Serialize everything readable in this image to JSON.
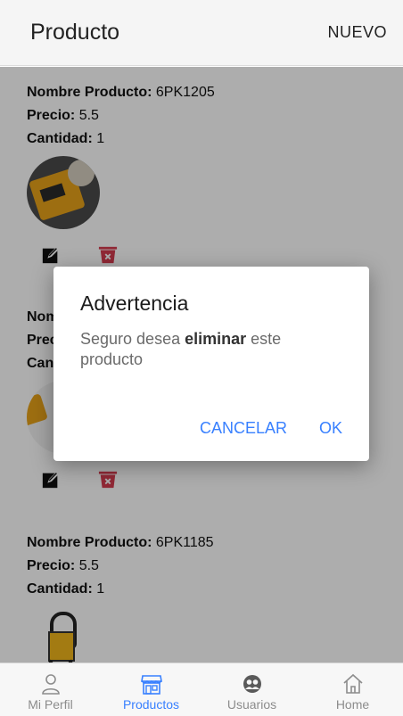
{
  "header": {
    "title": "Producto",
    "new_label": "NUEVO"
  },
  "products": [
    {
      "name_label": "Nombre Producto:",
      "name": "6PK1205",
      "price_label": "Precio:",
      "price": "5.5",
      "qty_label": "Cantidad:",
      "qty": "1"
    },
    {
      "name_label": "Nombre Producto:",
      "name": "",
      "price_label": "Precio:",
      "price": "",
      "qty_label": "Cantidad:",
      "qty": ""
    },
    {
      "name_label": "Nombre Producto:",
      "name": "6PK1185",
      "price_label": "Precio:",
      "price": "5.5",
      "qty_label": "Cantidad:",
      "qty": "1"
    }
  ],
  "dialog": {
    "title": "Advertencia",
    "message_pre": "Seguro desea",
    "message_bold": "eliminar",
    "message_post": "este producto",
    "cancel_label": "CANCELAR",
    "ok_label": "OK"
  },
  "tabs": [
    {
      "label": "Mi Perfil",
      "icon": "person-icon",
      "active": false
    },
    {
      "label": "Productos",
      "icon": "storefront-icon",
      "active": true
    },
    {
      "label": "Usuarios",
      "icon": "users-icon",
      "active": false
    },
    {
      "label": "Home",
      "icon": "home-icon",
      "active": false
    }
  ],
  "colors": {
    "accent": "#3880ff",
    "danger": "#d43b4e",
    "text": "#111111"
  }
}
